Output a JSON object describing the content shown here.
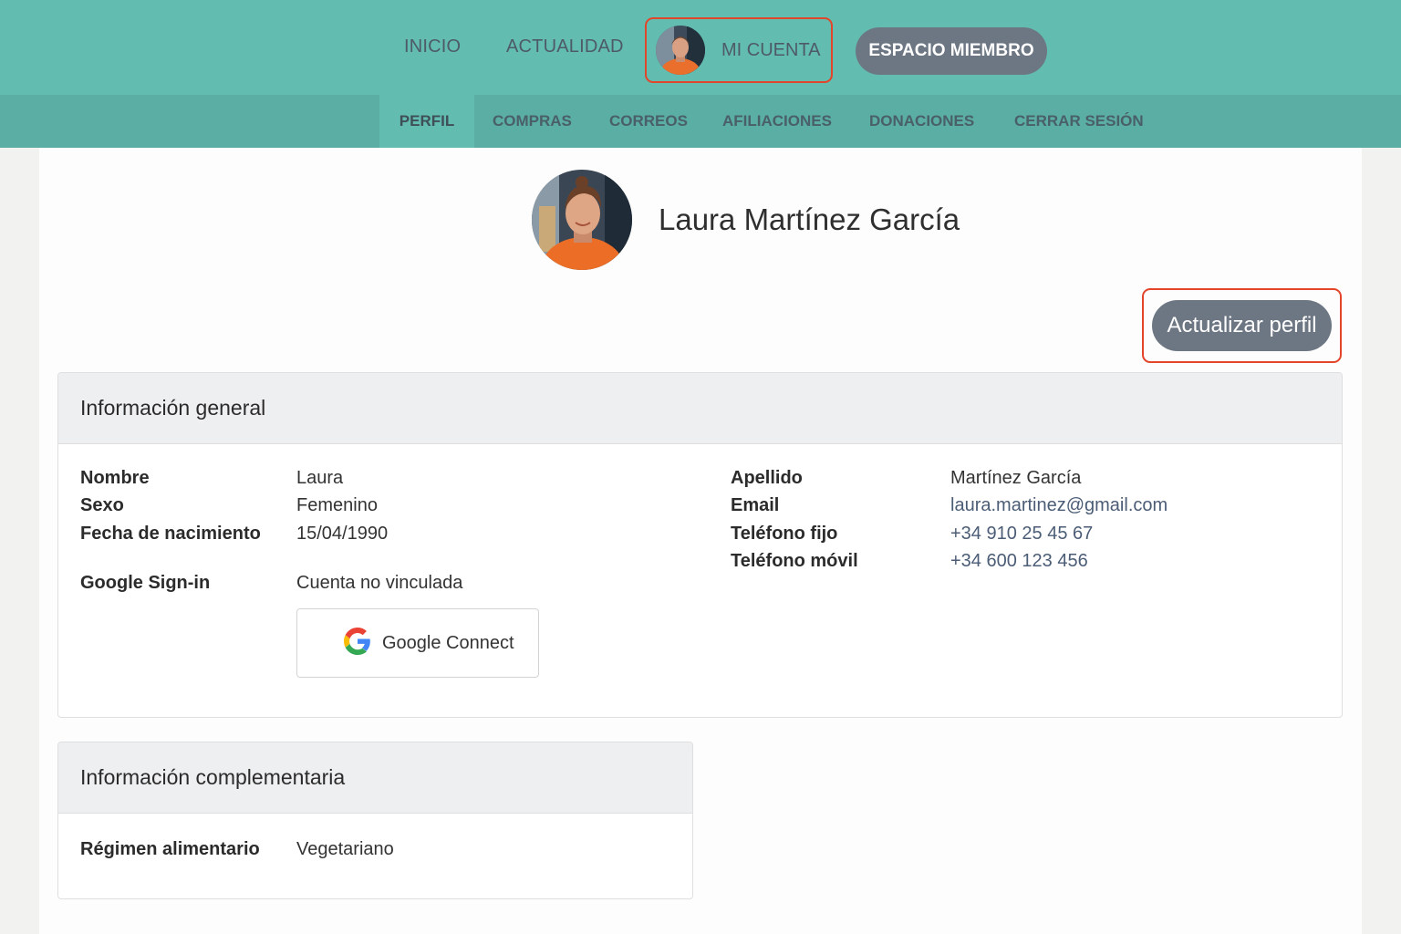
{
  "topnav": {
    "inicio": "INICIO",
    "actualidad": "ACTUALIDAD",
    "mi_cuenta": "MI CUENTA",
    "espacio_miembro": "ESPACIO MIEMBRO"
  },
  "subnav": {
    "perfil": "PERFIL",
    "compras": "COMPRAS",
    "correos": "CORREOS",
    "afiliaciones": "AFILIACIONES",
    "donaciones": "DONACIONES",
    "cerrar_sesion": "CERRAR SESIÓN",
    "active": "PERFIL"
  },
  "profile": {
    "name": "Laura Martínez García",
    "update_button": "Actualizar perfil"
  },
  "general": {
    "title": "Información general",
    "nombre_label": "Nombre",
    "nombre_value": "Laura",
    "sexo_label": "Sexo",
    "sexo_value": "Femenino",
    "nacimiento_label": "Fecha de nacimiento",
    "nacimiento_value": "15/04/1990",
    "google_label": "Google Sign-in",
    "google_value": "Cuenta no vinculada",
    "google_button": "Google Connect",
    "apellido_label": "Apellido",
    "apellido_value": "Martínez García",
    "email_label": "Email",
    "email_value": "laura.martinez@gmail.com",
    "fijo_label": "Teléfono fijo",
    "fijo_value": "+34 910 25 45 67",
    "movil_label": "Teléfono móvil",
    "movil_value": "+34 600 123 456"
  },
  "complementaria": {
    "title": "Información complementaria",
    "regimen_label": "Régimen alimentario",
    "regimen_value": "Vegetariano"
  },
  "colors": {
    "topbar": "#62bcb0",
    "subbar": "#5aaea3",
    "button_gray": "#6d7784",
    "highlight_red": "#e2452a",
    "link": "#4b5d76"
  },
  "icons": [
    "user-avatar",
    "google-g-icon"
  ]
}
